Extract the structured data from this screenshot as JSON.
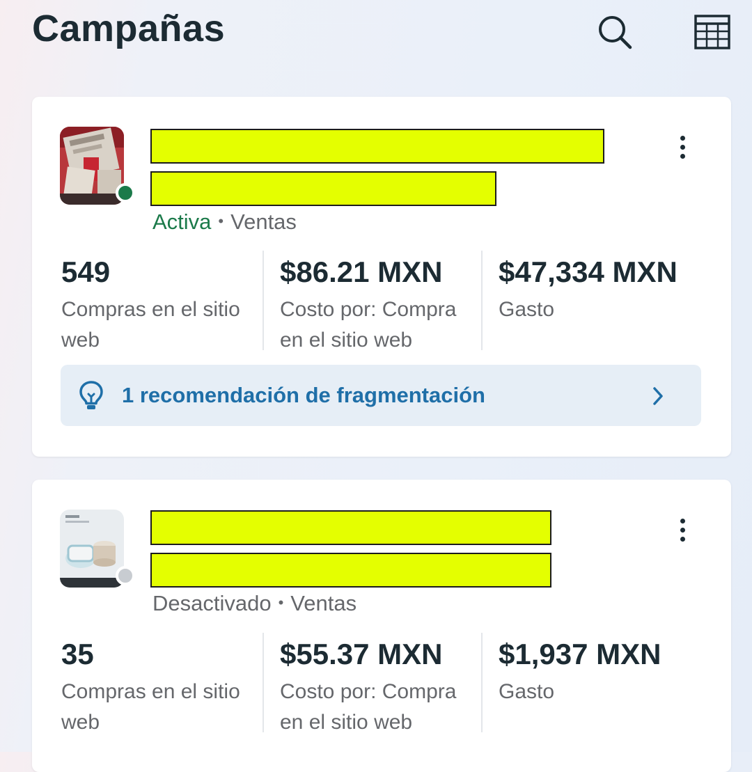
{
  "header": {
    "title": "Campañas",
    "search_icon": "search-icon",
    "table_icon": "table-view-icon"
  },
  "campaigns": [
    {
      "status": "Activa",
      "separator": "•",
      "objective": "Ventas",
      "status_color": "#1b7a4a",
      "metrics": [
        {
          "value": "549",
          "label": "Compras en el sitio web"
        },
        {
          "value": "$86.21 MXN",
          "label": "Costo por: Compra en el sitio web"
        },
        {
          "value": "$47,334 MXN",
          "label": "Gasto"
        }
      ],
      "recommendation": "1 recomendación de fragmentación"
    },
    {
      "status": "Desactivado",
      "separator": "•",
      "objective": "Ventas",
      "status_color": "#c8ccd1",
      "metrics": [
        {
          "value": "35",
          "label": "Compras en el sitio web"
        },
        {
          "value": "$55.37 MXN",
          "label": "Costo por: Compra en el sitio web"
        },
        {
          "value": "$1,937 MXN",
          "label": "Gasto"
        }
      ]
    }
  ],
  "colors": {
    "redaction": "#e4ff00",
    "accent_blue": "#1f6fa8",
    "active_green": "#1b7a4a"
  }
}
